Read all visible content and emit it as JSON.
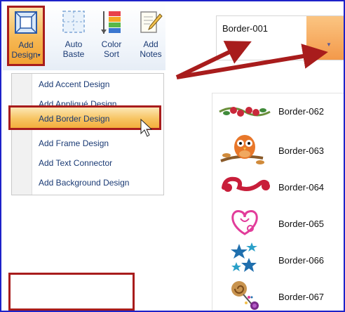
{
  "ribbon": {
    "buttons": [
      {
        "name": "add-design",
        "line1": "Add",
        "line2": "Design",
        "icon": "add-design-icon"
      },
      {
        "name": "auto-baste",
        "line1": "Auto",
        "line2": "Baste",
        "icon": "auto-baste-icon"
      },
      {
        "name": "color-sort",
        "line1": "Color",
        "line2": "Sort",
        "icon": "color-sort-icon"
      },
      {
        "name": "add-notes",
        "line1": "Add",
        "line2": "Notes",
        "icon": "add-notes-icon"
      }
    ],
    "dropdown_caret": "▾"
  },
  "menu": {
    "items": [
      "Add Accent Design",
      "Add Appliqué Design",
      "Add Border Design",
      "Add Frame Design",
      "Add Text Connector",
      "Add Background Design"
    ],
    "highlighted_index": 2
  },
  "combo": {
    "value": "Border-001",
    "arrow": "▼"
  },
  "list": {
    "items": [
      "Border-062",
      "Border-063",
      "Border-064",
      "Border-065",
      "Border-066",
      "Border-067"
    ],
    "selected": "Border-067"
  },
  "colors": {
    "annotation": "#a81c1c",
    "frame": "#1d22c9",
    "highlight": "#f3ae3d",
    "ribbon_text": "#1a3a74"
  }
}
